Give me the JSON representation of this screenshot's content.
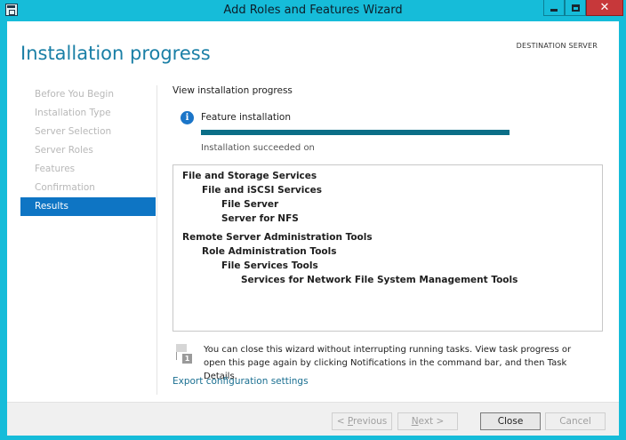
{
  "window": {
    "title": "Add Roles and Features Wizard"
  },
  "header": {
    "page_title": "Installation progress",
    "destination_label": "DESTINATION SERVER"
  },
  "nav": {
    "items": [
      {
        "label": "Before You Begin",
        "active": false
      },
      {
        "label": "Installation Type",
        "active": false
      },
      {
        "label": "Server Selection",
        "active": false
      },
      {
        "label": "Server Roles",
        "active": false
      },
      {
        "label": "Features",
        "active": false
      },
      {
        "label": "Confirmation",
        "active": false
      },
      {
        "label": "Results",
        "active": true
      }
    ]
  },
  "main": {
    "subheading": "View installation progress",
    "feature_label": "Feature installation",
    "progress_percent": 100,
    "status": "Installation succeeded on",
    "results": [
      {
        "text": "File and Storage Services",
        "level": 0
      },
      {
        "text": "File and iSCSI Services",
        "level": 1
      },
      {
        "text": "File Server",
        "level": 2
      },
      {
        "text": "Server for NFS",
        "level": 2
      },
      {
        "text": "Remote Server Administration Tools",
        "level": 0
      },
      {
        "text": "Role Administration Tools",
        "level": 1
      },
      {
        "text": "File Services Tools",
        "level": 2
      },
      {
        "text": "Services for Network File System Management Tools",
        "level": 3
      }
    ],
    "note_badge": "1",
    "note": "You can close this wizard without interrupting running tasks. View task progress or open this page again by clicking Notifications in the command bar, and then Task Details.",
    "export_link": "Export configuration settings"
  },
  "footer": {
    "previous_prefix": "< ",
    "previous_accel": "P",
    "previous_rest": "revious",
    "next_accel": "N",
    "next_rest": "ext >",
    "close_label": "Close",
    "cancel_label": "Cancel"
  },
  "colors": {
    "titlebar": "#16bcd9",
    "accent": "#1a7fa6",
    "nav_active": "#0e75c4",
    "progress": "#0b6e87",
    "close_button": "#c7383a"
  }
}
